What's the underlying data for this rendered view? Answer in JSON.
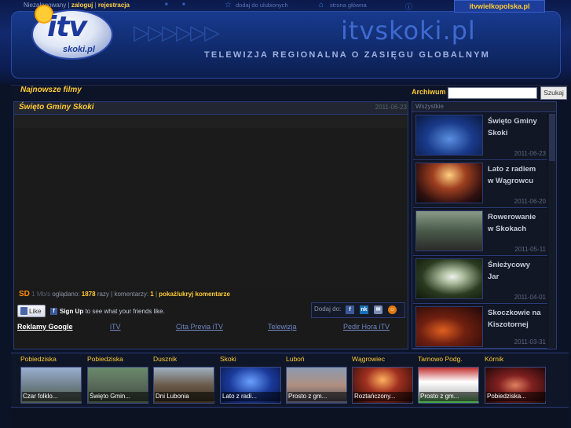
{
  "header": {
    "not_logged": "Niezalogowany",
    "login": "zaloguj",
    "register": "rejestracja",
    "add_favorites": "dodaj do ulubionych",
    "home_page": "strona główna",
    "region_tab": "itvwielkopolska.pl",
    "logo_main": "itv",
    "logo_sub": "skoki.pl",
    "site_name": "itvskoki.pl",
    "tagline": "TELEWIZJA REGIONALNA O ZASIĘGU GLOBALNYM"
  },
  "nav": {
    "newest": "Najnowsze filmy",
    "archive": "Archiwum",
    "search_button": "Szukaj"
  },
  "video": {
    "title": "Święto Gminy Skoki",
    "date": "2011-06-23",
    "quality": "SD",
    "bitrate": "1 Mb/s",
    "viewed_label": "oglądano:",
    "views": "1878",
    "times_label": "razy",
    "comments_label": "komentarzy:",
    "comments": "1",
    "toggle_comments": "pokaż/ukryj komentarze",
    "like": "Like",
    "fb_signup": "Sign Up",
    "fb_text": "to see what your friends like.",
    "share_label": "Dodaj do:"
  },
  "links": {
    "ads": "Reklamy Google",
    "items": [
      "iTV",
      "Cita Previa iTV",
      "Telewizja",
      "Pedir Hora iTV"
    ]
  },
  "sidebar": {
    "header": "Wszystkie",
    "items": [
      {
        "title": "Święto Gminy Skoki",
        "date": "2011-06-23"
      },
      {
        "title": "Lato z radiem w Wągrowcu",
        "date": "2011-06-20"
      },
      {
        "title": "Rowerowanie w Skokach",
        "date": "2011-05-11"
      },
      {
        "title": "Śnieżycowy Jar",
        "date": "2011-04-01"
      },
      {
        "title": "Skoczkowie na Kiszotornej",
        "date": "2011-03-31"
      }
    ]
  },
  "towns": [
    {
      "name": "Pobiedziska",
      "caption": "Czar folklo..."
    },
    {
      "name": "Pobiedziska",
      "caption": "Święto Gmin..."
    },
    {
      "name": "Dusznik",
      "caption": "Dni Lubonia"
    },
    {
      "name": "Skoki",
      "caption": "Lato z radi..."
    },
    {
      "name": "Luboń",
      "caption": "Prosto z gm..."
    },
    {
      "name": "Wągrowiec",
      "caption": "Roztańczony..."
    },
    {
      "name": "Tarnowo Podg.",
      "caption": "Prosto z gm..."
    },
    {
      "name": "Kórnik",
      "caption": "Pobiedziska..."
    }
  ],
  "colors": {
    "accent": "#ffcc33",
    "panel_border": "#2b3b78",
    "link": "#6f86c4"
  }
}
